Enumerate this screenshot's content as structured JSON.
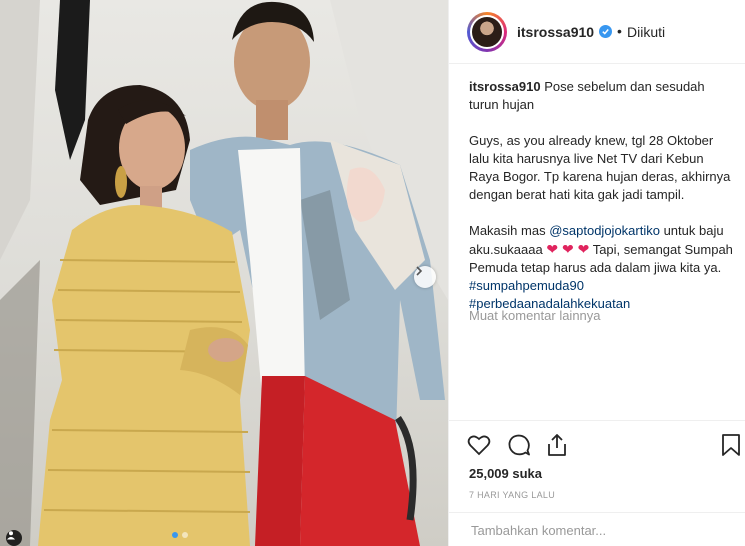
{
  "post": {
    "photo": {
      "alt_icon": "tagged-people-icon",
      "next_icon": "chevron-right-icon",
      "carousel_count": 2,
      "carousel_active": 1
    },
    "header": {
      "username": "itsrossa910",
      "verified_icon": "verified-badge-icon",
      "separator": "•",
      "follow_status": "Diikuti"
    },
    "caption": {
      "username": "itsrossa910",
      "line1": "Pose sebelum dan sesudah turun hujan",
      "para2": "Guys, as you already knew, tgl 28 Oktober lalu kita harusnya live Net TV dari Kebun Raya Bogor. Tp karena hujan deras, akhirnya dengan berat hati kita gak jadi tampil.",
      "para3_before": "Makasih mas ",
      "mention": "@saptodjojokartiko",
      "para3_after": " untuk baju aku.sukaaaa ",
      "hearts": "❤ ❤ ❤",
      "para3_end": " Tapi, semangat Sumpah Pemuda tetap harus ada dalam jiwa kita ya.",
      "hashtag1": "#sumpahpemuda90",
      "hashtag2": "#perbedaanadalahkekuatan"
    },
    "more_comments": "Muat komentar lainnya",
    "actions": {
      "like_icon": "heart-outline-icon",
      "comment_icon": "comment-bubble-icon",
      "share_icon": "share-icon",
      "save_icon": "bookmark-icon"
    },
    "likes": "25,009 suka",
    "timestamp": "7 HARI YANG LALU",
    "add_comment_placeholder": "Tambahkan komentar..."
  },
  "colors": {
    "link": "#003569",
    "verified": "#3897f0",
    "muted": "#999999",
    "heart": "#e0245e"
  }
}
